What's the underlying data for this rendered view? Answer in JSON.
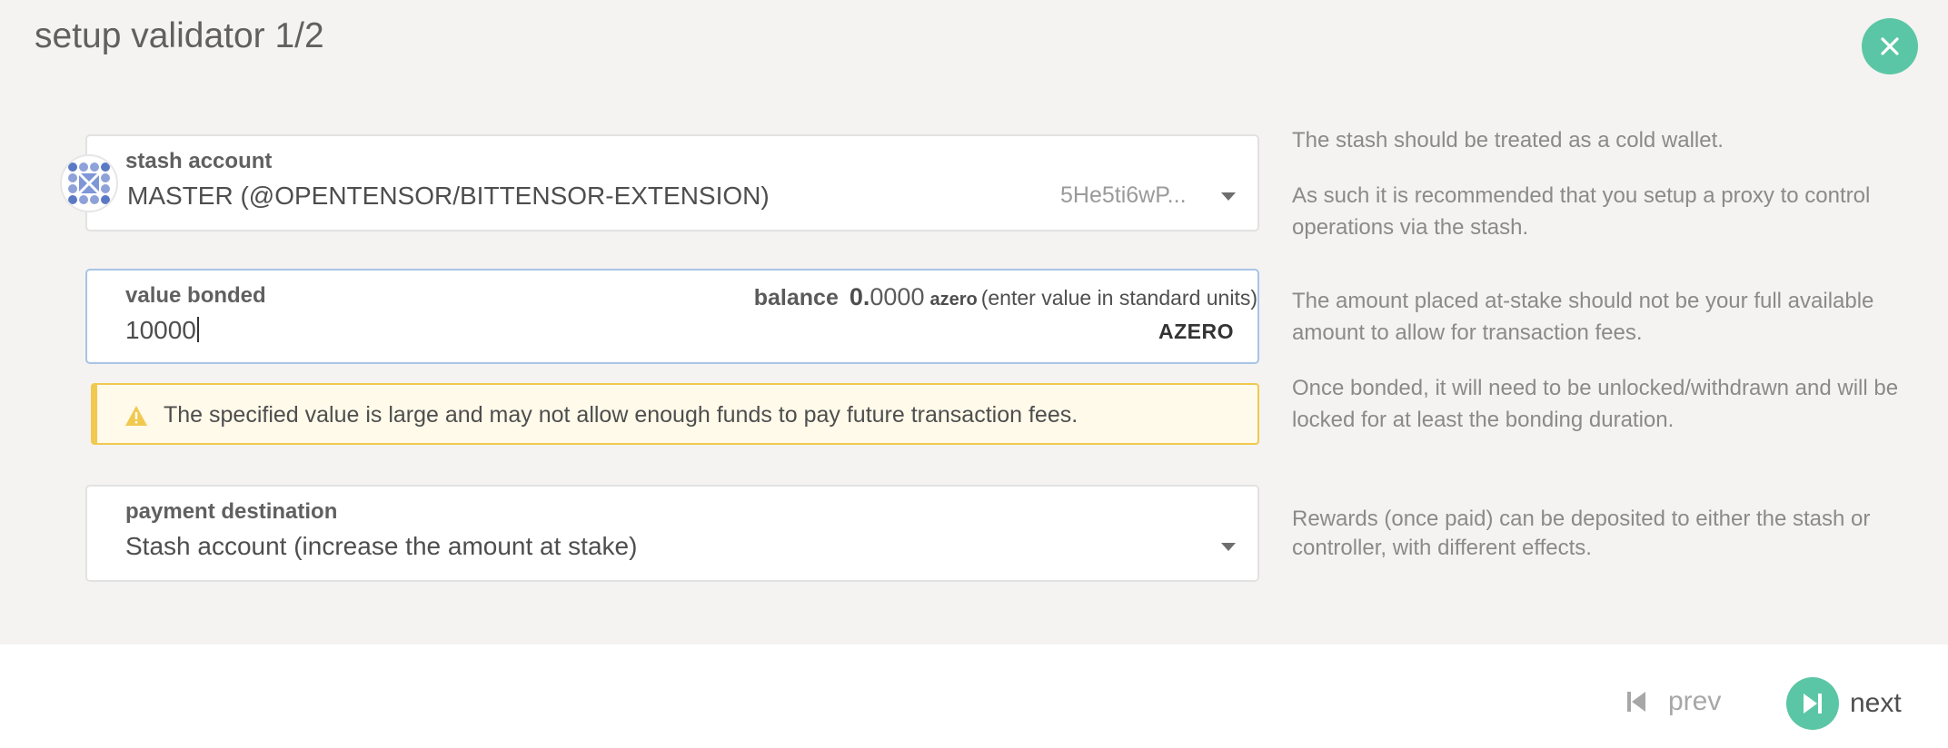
{
  "modal": {
    "title": "setup validator 1/2"
  },
  "stash": {
    "label": "stash account",
    "value": "MASTER (@OPENTENSOR/BITTENSOR-EXTENSION)",
    "address": "5He5ti6wP..."
  },
  "bonded": {
    "label": "value bonded",
    "value": "10000",
    "balance_label": "balance",
    "balance_int": "0.",
    "balance_frac": "0000",
    "balance_unit": "azero",
    "balance_hint": "(enter value in standard units)",
    "unit": "AZERO"
  },
  "warning": {
    "text": "The specified value is large and may not allow enough funds to pay future transaction fees."
  },
  "payment": {
    "label": "payment destination",
    "value": "Stash account (increase the amount at stake)"
  },
  "help": {
    "stash_1": "The stash should be treated as a cold wallet.",
    "stash_2": "As such it is recommended that you setup a proxy to control operations via the stash.",
    "bonded_1": "The amount placed at-stake should not be your full available amount to allow for transaction fees.",
    "bonded_2": "Once bonded, it will need to be unlocked/withdrawn and will be locked for at least the bonding duration.",
    "payment_1": "Rewards (once paid) can be deposited to either the stash or controller, with different effects."
  },
  "nav": {
    "prev_label": "prev",
    "next_label": "next"
  },
  "colors": {
    "accent": "#5bc6a5",
    "warning": "#f1c94f",
    "active_border": "#a8c4e6"
  }
}
